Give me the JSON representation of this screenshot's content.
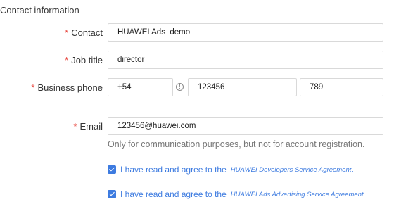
{
  "section": {
    "title": "Contact information"
  },
  "contact": {
    "label": "Contact",
    "value": "HUAWEI Ads  demo"
  },
  "job_title": {
    "label": "Job title",
    "value": "director"
  },
  "business_phone": {
    "label": "Business phone",
    "country_code": "+54",
    "number": "123456",
    "extension": "789"
  },
  "email": {
    "label": "Email",
    "value": "123456@huawei.com",
    "hint": "Only for communication purposes, but not for account registration."
  },
  "agreements": [
    {
      "checked": true,
      "text": "I have read and agree to the",
      "link": "HUAWEI Developers Service Agreement",
      "suffix": "."
    },
    {
      "checked": true,
      "text": "I have read and agree to the",
      "link": "HUAWEI Ads Advertising Service Agreement",
      "suffix": "."
    }
  ],
  "colors": {
    "required": "#e8463e",
    "accent": "#3d7be0",
    "border": "#d9d9d9",
    "hint": "#777777"
  },
  "icons": {
    "info": "info-circle-icon",
    "check": "checkmark-icon"
  },
  "required_mark": "*",
  "info_glyph": "!"
}
